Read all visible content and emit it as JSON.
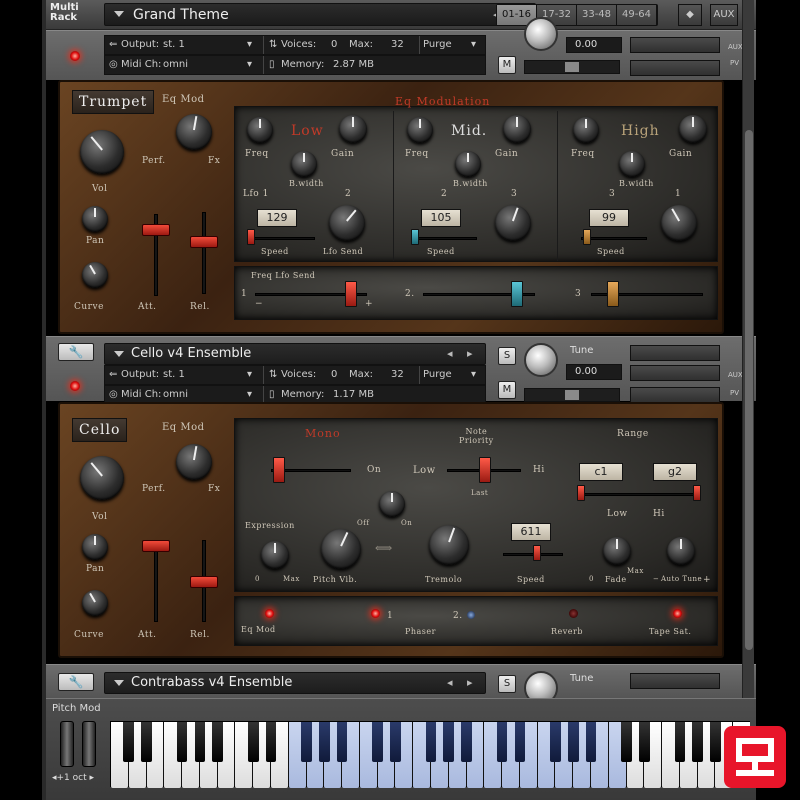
{
  "header": {
    "multi_rack_label": "Multi\nRack",
    "rack_name": "Grand Theme",
    "rack_tabs": [
      "01-16",
      "17-32",
      "33-48",
      "49-64"
    ],
    "active_tab": 0,
    "aux_label": "AUX",
    "pv_label": "PV"
  },
  "instruments": [
    {
      "name": "",
      "output_label": "Output:",
      "output_value": "st. 1",
      "midi_label": "Midi Ch:",
      "midi_value": "omni",
      "voices_label": "Voices:",
      "voices_value": "0",
      "max_label": "Max:",
      "max_value": "32",
      "purge_label": "Purge",
      "memory_label": "Memory:",
      "memory_value": "2.87 MB",
      "tune_value": "0.00",
      "m_label": "M",
      "aux_label": "AUX",
      "pv_label": "PV"
    },
    {
      "name": "Cello v4 Ensemble",
      "output_label": "Output:",
      "output_value": "st. 1",
      "midi_label": "Midi Ch:",
      "midi_value": "omni",
      "voices_label": "Voices:",
      "voices_value": "0",
      "max_label": "Max:",
      "max_value": "32",
      "purge_label": "Purge",
      "memory_label": "Memory:",
      "memory_value": "1.17 MB",
      "tune_label": "Tune",
      "tune_value": "0.00",
      "s_label": "S",
      "m_label": "M",
      "aux_label": "AUX",
      "pv_label": "PV"
    },
    {
      "name": "Contrabass v4 Ensemble",
      "tune_label": "Tune",
      "s_label": "S"
    }
  ],
  "trumpet_panel": {
    "name": "Trumpet",
    "eq_mod": "Eq Mod",
    "perf": "Perf.",
    "fx": "Fx",
    "vol": "Vol",
    "pan": "Pan",
    "curve": "Curve",
    "att": "Att.",
    "rel": "Rel.",
    "eq_modulation": "Eq Modulation",
    "bands": [
      {
        "name": "Low",
        "freq": "Freq",
        "gain": "Gain",
        "bwidth": "B.width",
        "lfo_a": "Lfo 1",
        "lfo_b": "2",
        "speed_value": "129",
        "speed": "Speed",
        "lfo_send": "Lfo Send",
        "cap_color": "#c8312a"
      },
      {
        "name": "Mid.",
        "freq": "Freq",
        "gain": "Gain",
        "bwidth": "B.width",
        "lfo_a": "2",
        "lfo_b": "3",
        "speed_value": "105",
        "speed": "Speed",
        "cap_color": "#2f8c9a"
      },
      {
        "name": "High",
        "freq": "Freq",
        "gain": "Gain",
        "bwidth": "B.width",
        "lfo_a": "3",
        "lfo_b": "1",
        "speed_value": "99",
        "speed": "Speed",
        "cap_color": "#c8893a"
      }
    ],
    "freq_lfo_send": "Freq Lfo Send",
    "send_rows": [
      "1",
      "2.",
      "3"
    ],
    "minus": "−",
    "plus": "+"
  },
  "cello_panel": {
    "name": "Cello",
    "eq_mod": "Eq Mod",
    "perf": "Perf.",
    "fx": "Fx",
    "vol": "Vol",
    "pan": "Pan",
    "curve": "Curve",
    "att": "Att.",
    "rel": "Rel.",
    "mono": "Mono",
    "on": "On",
    "low": "Low",
    "note_priority": "Note\nPriority",
    "last": "Last",
    "hi": "Hi",
    "range": "Range",
    "range_low": "c1",
    "range_high": "g2",
    "range_low_label": "Low",
    "range_high_label": "Hi",
    "expression": "Expression",
    "zero_a": "0",
    "max_a": "Max",
    "off": "Off",
    "on2": "On",
    "pitch_vib": "Pitch Vib.",
    "tremolo": "Tremolo",
    "speed_value": "611",
    "speed": "Speed",
    "fade": "Fade",
    "zero_b": "0",
    "max_b": "Max",
    "auto_tune": "Auto Tune",
    "minus": "−",
    "plus": "+",
    "phaser": "Phaser",
    "phaser_1": "1",
    "phaser_2": "2.",
    "reverb": "Reverb",
    "tape_sat": "Tape Sat.",
    "eq_mod_led": "Eq Mod"
  },
  "keyboard": {
    "pitch_mod": "Pitch Mod",
    "octave": "◂+1 oct ▸"
  }
}
